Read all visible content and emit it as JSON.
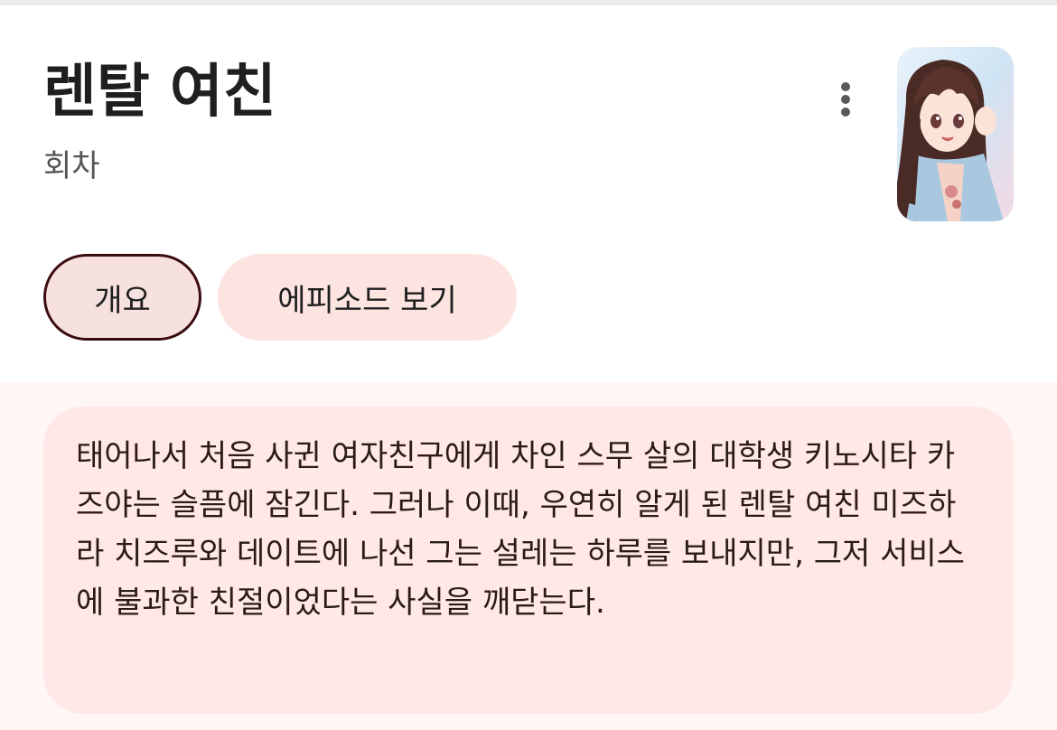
{
  "header": {
    "title": "렌탈 여친",
    "subtitle": "회차"
  },
  "icons": {
    "more": "more-vert-icon",
    "thumbnail": "cover-thumbnail"
  },
  "tabs": [
    {
      "label": "개요",
      "selected": true
    },
    {
      "label": "에피소드 보기",
      "selected": false
    }
  ],
  "overview": {
    "description": "태어나서 처음 사귄 여자친구에게 차인 스무 살의 대학생 키노시타 카즈야는 슬픔에 잠긴다. 그러나 이때, 우연히 알게 된 렌탈 여친 미즈하라 치즈루와 데이트에 나선 그는 설레는 하루를 보내지만, 그저 서비스에 불과한 친절이었다는 사실을 깨닫는다."
  },
  "colors": {
    "chip_selected_bg": "#f7e1df",
    "chip_selected_border": "#3a0c10",
    "chip_unselected_bg": "#fce4e1",
    "card_bg": "#ffe8e5",
    "section_bg": "#fff6f5"
  }
}
